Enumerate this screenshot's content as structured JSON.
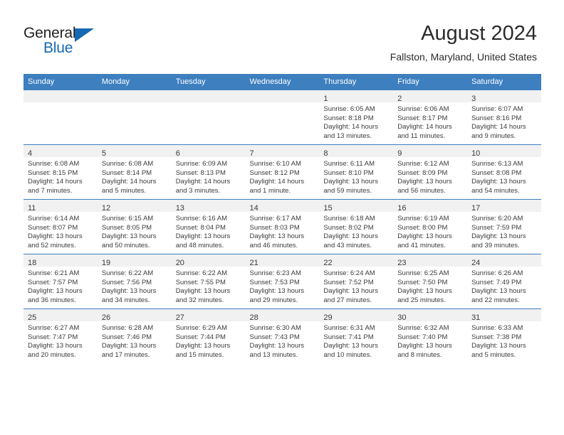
{
  "brand": {
    "name_part1": "General",
    "name_part2": "Blue",
    "triangle_color": "#1569b4",
    "text_color": "#231f20"
  },
  "header": {
    "title": "August 2024",
    "subtitle": "Fallston, Maryland, United States"
  },
  "theme": {
    "header_blue": "#3d7fbf",
    "daynum_band": "#f1f1f1",
    "text": "#3b3b3b"
  },
  "weekday_headers": [
    "Sunday",
    "Monday",
    "Tuesday",
    "Wednesday",
    "Thursday",
    "Friday",
    "Saturday"
  ],
  "weeks": [
    [
      {
        "day": "",
        "empty": true,
        "sunrise": "",
        "sunset": "",
        "daylight1": "",
        "daylight2": ""
      },
      {
        "day": "",
        "empty": true,
        "sunrise": "",
        "sunset": "",
        "daylight1": "",
        "daylight2": ""
      },
      {
        "day": "",
        "empty": true,
        "sunrise": "",
        "sunset": "",
        "daylight1": "",
        "daylight2": ""
      },
      {
        "day": "",
        "empty": true,
        "sunrise": "",
        "sunset": "",
        "daylight1": "",
        "daylight2": ""
      },
      {
        "day": "1",
        "empty": false,
        "sunrise": "Sunrise: 6:05 AM",
        "sunset": "Sunset: 8:18 PM",
        "daylight1": "Daylight: 14 hours",
        "daylight2": "and 13 minutes."
      },
      {
        "day": "2",
        "empty": false,
        "sunrise": "Sunrise: 6:06 AM",
        "sunset": "Sunset: 8:17 PM",
        "daylight1": "Daylight: 14 hours",
        "daylight2": "and 11 minutes."
      },
      {
        "day": "3",
        "empty": false,
        "sunrise": "Sunrise: 6:07 AM",
        "sunset": "Sunset: 8:16 PM",
        "daylight1": "Daylight: 14 hours",
        "daylight2": "and 9 minutes."
      }
    ],
    [
      {
        "day": "4",
        "empty": false,
        "sunrise": "Sunrise: 6:08 AM",
        "sunset": "Sunset: 8:15 PM",
        "daylight1": "Daylight: 14 hours",
        "daylight2": "and 7 minutes."
      },
      {
        "day": "5",
        "empty": false,
        "sunrise": "Sunrise: 6:08 AM",
        "sunset": "Sunset: 8:14 PM",
        "daylight1": "Daylight: 14 hours",
        "daylight2": "and 5 minutes."
      },
      {
        "day": "6",
        "empty": false,
        "sunrise": "Sunrise: 6:09 AM",
        "sunset": "Sunset: 8:13 PM",
        "daylight1": "Daylight: 14 hours",
        "daylight2": "and 3 minutes."
      },
      {
        "day": "7",
        "empty": false,
        "sunrise": "Sunrise: 6:10 AM",
        "sunset": "Sunset: 8:12 PM",
        "daylight1": "Daylight: 14 hours",
        "daylight2": "and 1 minute."
      },
      {
        "day": "8",
        "empty": false,
        "sunrise": "Sunrise: 6:11 AM",
        "sunset": "Sunset: 8:10 PM",
        "daylight1": "Daylight: 13 hours",
        "daylight2": "and 59 minutes."
      },
      {
        "day": "9",
        "empty": false,
        "sunrise": "Sunrise: 6:12 AM",
        "sunset": "Sunset: 8:09 PM",
        "daylight1": "Daylight: 13 hours",
        "daylight2": "and 56 minutes."
      },
      {
        "day": "10",
        "empty": false,
        "sunrise": "Sunrise: 6:13 AM",
        "sunset": "Sunset: 8:08 PM",
        "daylight1": "Daylight: 13 hours",
        "daylight2": "and 54 minutes."
      }
    ],
    [
      {
        "day": "11",
        "empty": false,
        "sunrise": "Sunrise: 6:14 AM",
        "sunset": "Sunset: 8:07 PM",
        "daylight1": "Daylight: 13 hours",
        "daylight2": "and 52 minutes."
      },
      {
        "day": "12",
        "empty": false,
        "sunrise": "Sunrise: 6:15 AM",
        "sunset": "Sunset: 8:05 PM",
        "daylight1": "Daylight: 13 hours",
        "daylight2": "and 50 minutes."
      },
      {
        "day": "13",
        "empty": false,
        "sunrise": "Sunrise: 6:16 AM",
        "sunset": "Sunset: 8:04 PM",
        "daylight1": "Daylight: 13 hours",
        "daylight2": "and 48 minutes."
      },
      {
        "day": "14",
        "empty": false,
        "sunrise": "Sunrise: 6:17 AM",
        "sunset": "Sunset: 8:03 PM",
        "daylight1": "Daylight: 13 hours",
        "daylight2": "and 46 minutes."
      },
      {
        "day": "15",
        "empty": false,
        "sunrise": "Sunrise: 6:18 AM",
        "sunset": "Sunset: 8:02 PM",
        "daylight1": "Daylight: 13 hours",
        "daylight2": "and 43 minutes."
      },
      {
        "day": "16",
        "empty": false,
        "sunrise": "Sunrise: 6:19 AM",
        "sunset": "Sunset: 8:00 PM",
        "daylight1": "Daylight: 13 hours",
        "daylight2": "and 41 minutes."
      },
      {
        "day": "17",
        "empty": false,
        "sunrise": "Sunrise: 6:20 AM",
        "sunset": "Sunset: 7:59 PM",
        "daylight1": "Daylight: 13 hours",
        "daylight2": "and 39 minutes."
      }
    ],
    [
      {
        "day": "18",
        "empty": false,
        "sunrise": "Sunrise: 6:21 AM",
        "sunset": "Sunset: 7:57 PM",
        "daylight1": "Daylight: 13 hours",
        "daylight2": "and 36 minutes."
      },
      {
        "day": "19",
        "empty": false,
        "sunrise": "Sunrise: 6:22 AM",
        "sunset": "Sunset: 7:56 PM",
        "daylight1": "Daylight: 13 hours",
        "daylight2": "and 34 minutes."
      },
      {
        "day": "20",
        "empty": false,
        "sunrise": "Sunrise: 6:22 AM",
        "sunset": "Sunset: 7:55 PM",
        "daylight1": "Daylight: 13 hours",
        "daylight2": "and 32 minutes."
      },
      {
        "day": "21",
        "empty": false,
        "sunrise": "Sunrise: 6:23 AM",
        "sunset": "Sunset: 7:53 PM",
        "daylight1": "Daylight: 13 hours",
        "daylight2": "and 29 minutes."
      },
      {
        "day": "22",
        "empty": false,
        "sunrise": "Sunrise: 6:24 AM",
        "sunset": "Sunset: 7:52 PM",
        "daylight1": "Daylight: 13 hours",
        "daylight2": "and 27 minutes."
      },
      {
        "day": "23",
        "empty": false,
        "sunrise": "Sunrise: 6:25 AM",
        "sunset": "Sunset: 7:50 PM",
        "daylight1": "Daylight: 13 hours",
        "daylight2": "and 25 minutes."
      },
      {
        "day": "24",
        "empty": false,
        "sunrise": "Sunrise: 6:26 AM",
        "sunset": "Sunset: 7:49 PM",
        "daylight1": "Daylight: 13 hours",
        "daylight2": "and 22 minutes."
      }
    ],
    [
      {
        "day": "25",
        "empty": false,
        "sunrise": "Sunrise: 6:27 AM",
        "sunset": "Sunset: 7:47 PM",
        "daylight1": "Daylight: 13 hours",
        "daylight2": "and 20 minutes."
      },
      {
        "day": "26",
        "empty": false,
        "sunrise": "Sunrise: 6:28 AM",
        "sunset": "Sunset: 7:46 PM",
        "daylight1": "Daylight: 13 hours",
        "daylight2": "and 17 minutes."
      },
      {
        "day": "27",
        "empty": false,
        "sunrise": "Sunrise: 6:29 AM",
        "sunset": "Sunset: 7:44 PM",
        "daylight1": "Daylight: 13 hours",
        "daylight2": "and 15 minutes."
      },
      {
        "day": "28",
        "empty": false,
        "sunrise": "Sunrise: 6:30 AM",
        "sunset": "Sunset: 7:43 PM",
        "daylight1": "Daylight: 13 hours",
        "daylight2": "and 13 minutes."
      },
      {
        "day": "29",
        "empty": false,
        "sunrise": "Sunrise: 6:31 AM",
        "sunset": "Sunset: 7:41 PM",
        "daylight1": "Daylight: 13 hours",
        "daylight2": "and 10 minutes."
      },
      {
        "day": "30",
        "empty": false,
        "sunrise": "Sunrise: 6:32 AM",
        "sunset": "Sunset: 7:40 PM",
        "daylight1": "Daylight: 13 hours",
        "daylight2": "and 8 minutes."
      },
      {
        "day": "31",
        "empty": false,
        "sunrise": "Sunrise: 6:33 AM",
        "sunset": "Sunset: 7:38 PM",
        "daylight1": "Daylight: 13 hours",
        "daylight2": "and 5 minutes."
      }
    ]
  ]
}
